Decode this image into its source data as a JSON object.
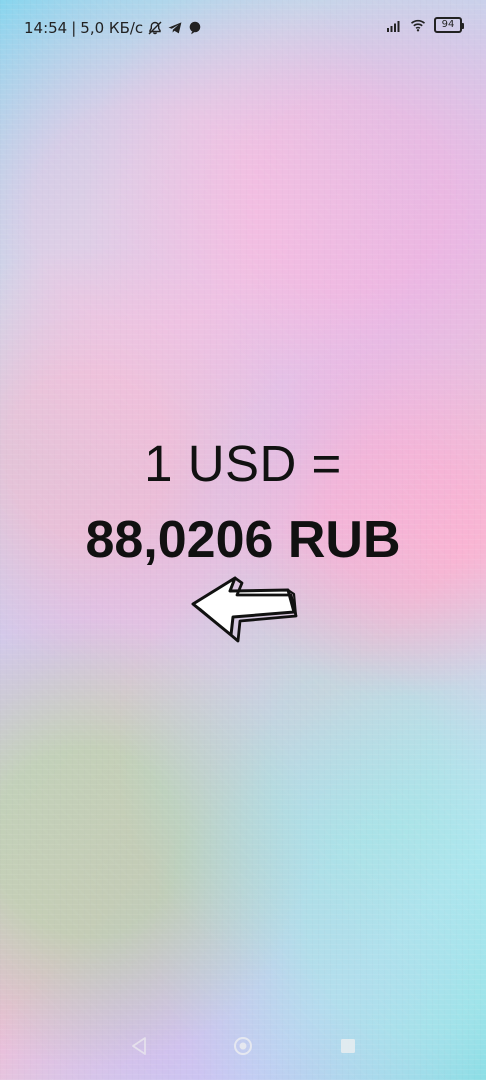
{
  "status_bar": {
    "time": "14:54",
    "separator": "|",
    "data_speed": "5,0 КБ/с",
    "battery_level": "94",
    "icons": [
      "muted-notification-icon",
      "telegram-icon",
      "chat-icon",
      "signal-icon",
      "wifi-icon",
      "battery-icon"
    ]
  },
  "rate": {
    "line1": "1 USD =",
    "line2": "88,0206 RUB"
  },
  "arrow_icon": "left-arrow-icon",
  "nav_bar": {
    "icons": [
      "back-icon",
      "home-icon",
      "recent-apps-icon"
    ]
  },
  "theme": {
    "text_color": "#111111",
    "accent": "#222222"
  }
}
